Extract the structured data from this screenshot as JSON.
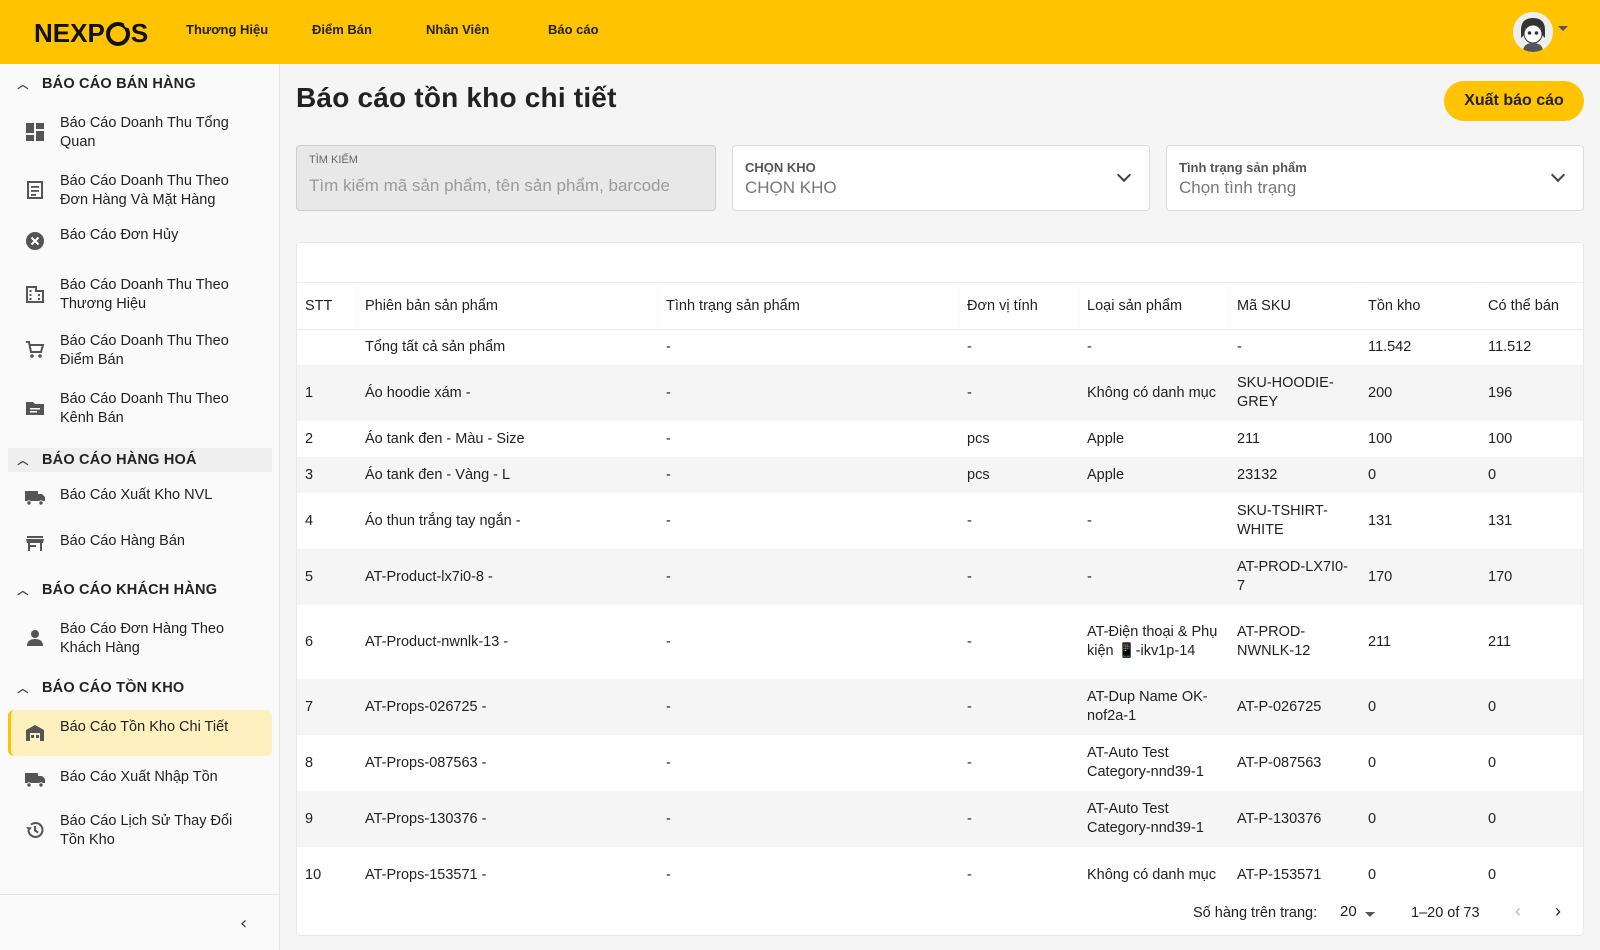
{
  "header": {
    "logo_text": "NEXPOS",
    "nav": [
      "Thương Hiệu",
      "Điểm Bán",
      "Nhân Viên",
      "Báo cáo"
    ]
  },
  "sidebar": {
    "sections": [
      {
        "title": "BÁO CÁO BÁN HÀNG",
        "items": [
          {
            "label": "Báo Cáo Doanh Thu Tổng Quan",
            "icon": "dashboard-icon"
          },
          {
            "label": "Báo Cáo Doanh Thu Theo Đơn Hàng Và Mặt Hàng",
            "icon": "receipt-icon"
          },
          {
            "label": "Báo Cáo Đơn Hủy",
            "icon": "cancel-icon"
          },
          {
            "label": "Báo Cáo Doanh Thu Theo Thương Hiệu",
            "icon": "building-icon"
          },
          {
            "label": "Báo Cáo Doanh Thu Theo Điểm Bán",
            "icon": "cart-icon"
          },
          {
            "label": "Báo Cáo Doanh Thu Theo Kênh Bán",
            "icon": "folder-icon"
          }
        ]
      },
      {
        "title": "BÁO CÁO HÀNG HOÁ",
        "items": [
          {
            "label": "Báo Cáo Xuất Kho NVL",
            "icon": "truck-icon"
          },
          {
            "label": "Báo Cáo Hàng Bán",
            "icon": "store-icon"
          }
        ]
      },
      {
        "title": "BÁO CÁO KHÁCH HÀNG",
        "items": [
          {
            "label": "Báo Cáo Đơn Hàng Theo Khách Hàng",
            "icon": "person-icon"
          }
        ]
      },
      {
        "title": "BÁO CÁO TỒN KHO",
        "items": [
          {
            "label": "Báo Cáo Tồn Kho Chi Tiết",
            "icon": "warehouse-icon",
            "active": true
          },
          {
            "label": "Báo Cáo Xuất Nhập Tồn",
            "icon": "truck-icon"
          },
          {
            "label": "Báo Cáo Lịch Sử Thay Đổi Tồn Kho",
            "icon": "history-icon"
          }
        ]
      }
    ]
  },
  "main": {
    "title": "Báo cáo tồn kho chi tiết",
    "export_label": "Xuất báo cáo",
    "search": {
      "label": "TÌM KIẾM",
      "placeholder": "Tìm kiếm mã sản phẩm, tên sản phẩm, barcode"
    },
    "warehouse": {
      "label": "CHỌN KHO",
      "value": "CHỌN KHO"
    },
    "status": {
      "label": "Tình trạng sản phẩm",
      "value": "Chọn tình trạng"
    },
    "table": {
      "columns": [
        "STT",
        "Phiên bản sản phẩm",
        "Tình trạng sản phẩm",
        "Đơn vị tính",
        "Loại sản phẩm",
        "Mã SKU",
        "Tồn kho",
        "Có thể bán"
      ],
      "rows": [
        [
          "",
          "Tổng tất cả sản phẩm",
          "-",
          "-",
          "-",
          "-",
          "11.542",
          "11.512"
        ],
        [
          "1",
          "Áo hoodie xám -",
          "-",
          "-",
          "Không có danh mục",
          "SKU-HOODIE-GREY",
          "200",
          "196"
        ],
        [
          "2",
          "Áo tank đen - Màu - Size",
          "-",
          "pcs",
          "Apple",
          "211",
          "100",
          "100"
        ],
        [
          "3",
          "Áo tank đen - Vàng - L",
          "-",
          "pcs",
          "Apple",
          "23132",
          "0",
          "0"
        ],
        [
          "4",
          "Áo thun trắng tay ngắn -",
          "-",
          "-",
          "-",
          "SKU-TSHIRT-WHITE",
          "131",
          "131"
        ],
        [
          "5",
          "AT-Product-lx7i0-8 -",
          "-",
          "-",
          "-",
          "AT-PROD-LX7I0-7",
          "170",
          "170"
        ],
        [
          "6",
          "AT-Product-nwnlk-13 -",
          "-",
          "-",
          "AT-Điện thoại & Phụ kiện 📱-ikv1p-14",
          "AT-PROD-NWNLK-12",
          "211",
          "211"
        ],
        [
          "7",
          "AT-Props-026725 -",
          "-",
          "-",
          "AT-Dup Name OK-nof2a-1",
          "AT-P-026725",
          "0",
          "0"
        ],
        [
          "8",
          "AT-Props-087563 -",
          "-",
          "-",
          "AT-Auto Test Category-nnd39-1",
          "AT-P-087563",
          "0",
          "0"
        ],
        [
          "9",
          "AT-Props-130376 -",
          "-",
          "-",
          "AT-Auto Test Category-nnd39-1",
          "AT-P-130376",
          "0",
          "0"
        ],
        [
          "10",
          "AT-Props-153571 -",
          "-",
          "-",
          "Không có danh mục",
          "AT-P-153571",
          "0",
          "0"
        ]
      ]
    },
    "pager": {
      "rows_label": "Số hàng trên trang:",
      "rows_value": "20",
      "range": "1–20 of 73"
    }
  },
  "colors": {
    "brand": "#FFC300",
    "active_bg": "#FFF0BF"
  }
}
